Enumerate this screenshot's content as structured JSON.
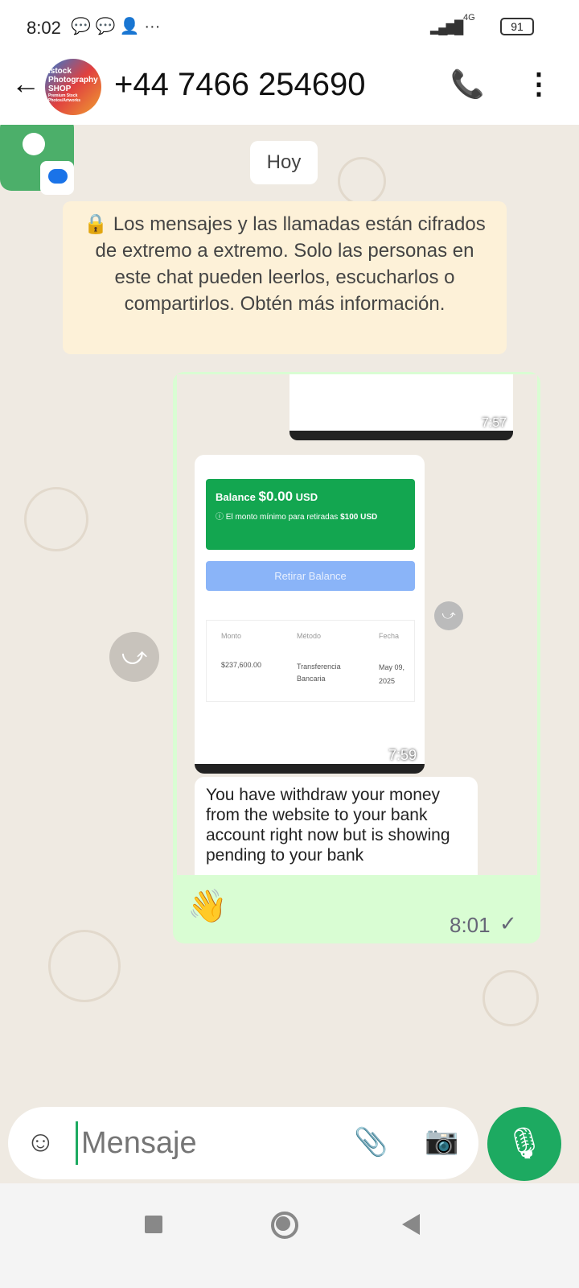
{
  "status": {
    "time": "8:02",
    "network": "4G",
    "battery": "91"
  },
  "header": {
    "contact": "+44 7466 254690",
    "avatar_text": "Istock Photography SHOP",
    "avatar_sub": "Premium Stock Photos/Artworks"
  },
  "chat": {
    "date_chip": "Hoy",
    "encryption_notice": "Los mensajes y las llamadas están cifrados de extremo a extremo. Solo las personas en este chat pueden leerlos, escucharlos o compartirlos. Obtén más información.",
    "forwarded_image": {
      "time_top": "7:57",
      "time_inner": "7:59",
      "balance_label": "Balance",
      "balance_amount": "$0.00",
      "balance_currency": "USD",
      "min_note": "El monto mínimo para retiradas",
      "min_amount": "$100",
      "min_currency": "USD",
      "withdraw_button": "Retirar Balance",
      "table_headers": [
        "Monto",
        "Método",
        "Fecha"
      ],
      "table_row": [
        "$237,600.00",
        "Transferencia Bancaria",
        "May 09, 2025"
      ],
      "text_message": "You have withdraw your money from the website to your bank account right now but is showing pending to your bank"
    },
    "message": {
      "emoji": "👋",
      "time": "8:01"
    }
  },
  "input": {
    "placeholder": "Mensaje"
  }
}
